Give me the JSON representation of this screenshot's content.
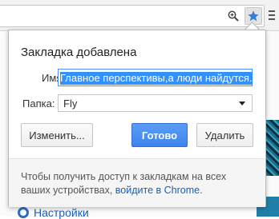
{
  "bubble": {
    "title": "Закладка добавлена",
    "name_label": "Имя:",
    "name_value": "Главное перспективы,а люди найдутся.",
    "folder_label": "Папка:",
    "folder_value": "Fly",
    "edit_button": "Изменить...",
    "done_button": "Готово",
    "delete_button": "Удалить",
    "footer_text": "Чтобы получить доступ к закладкам на всех ваших устройствах,",
    "footer_link": "войдите в Chrome",
    "footer_end": "."
  },
  "page": {
    "settings_link": "Настройки"
  },
  "icons": {
    "zoom": "zoom-icon",
    "star": "bookmark-star-icon",
    "menu": "menu-icon",
    "settings": "gear-icon"
  },
  "colors": {
    "accent": "#3d84ee",
    "star": "#3a7bd5",
    "link": "#1a5fb4",
    "selection": "#3390ff"
  }
}
